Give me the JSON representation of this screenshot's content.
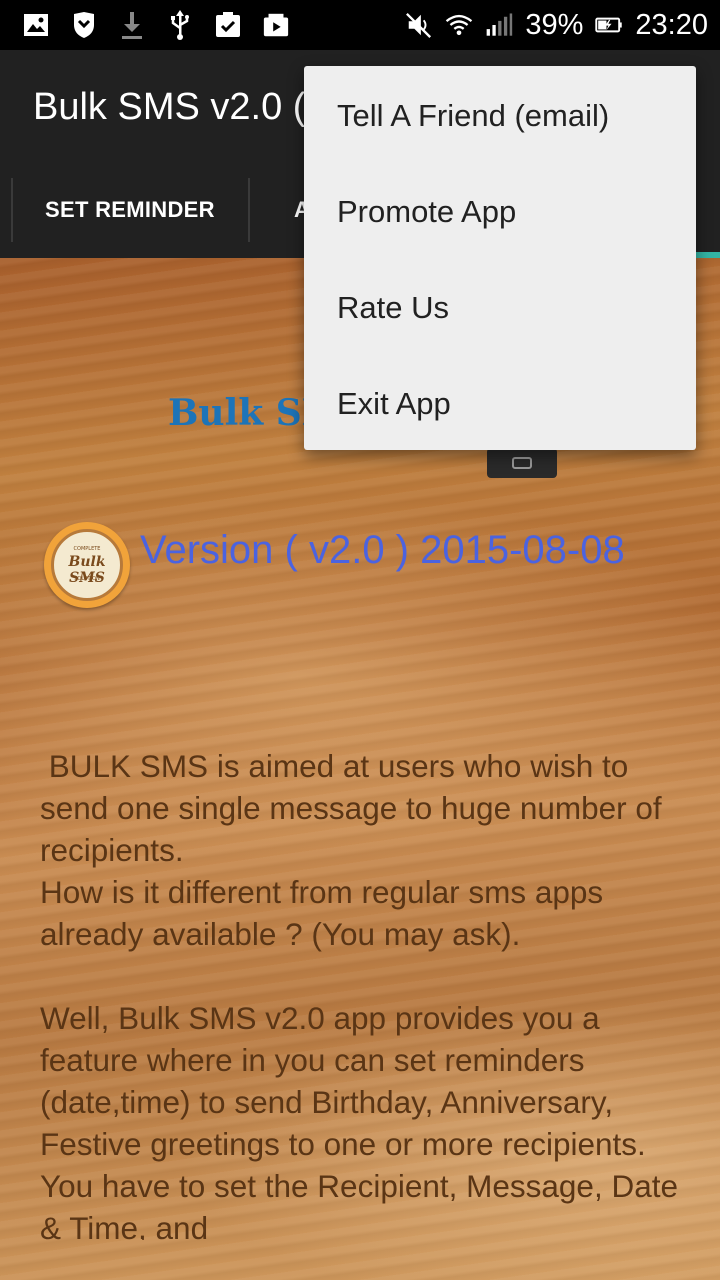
{
  "status_bar": {
    "battery": "39%",
    "time": "23:20",
    "left_icons": [
      "image-icon",
      "shield-icon",
      "download-icon",
      "usb-icon",
      "clipboard-check-icon",
      "video-icon"
    ],
    "right_icons": [
      "mute-icon",
      "wifi-icon",
      "signal-icon",
      "battery-charging-icon"
    ]
  },
  "app_bar": {
    "title": "Bulk SMS v2.0 ("
  },
  "tabs": [
    {
      "label": "SET REMINDER"
    },
    {
      "label": "A"
    }
  ],
  "content": {
    "logo_text": "Bulk SMS",
    "badge_text": "Bulk SMS",
    "badge_sub_top": "COMPLETE",
    "badge_sub_bottom": "SOLUTION",
    "version": "Version ( v2.0 ) 2015-08-08",
    "description": " BULK SMS is aimed at users who wish to send one single message to huge number of recipients.\nHow is it different from regular sms apps already available ? (You may ask).\n\nWell, Bulk SMS v2.0 app provides you a feature where in you can set reminders (date,time) to send Birthday, Anniversary, Festive greetings to one or more recipients. You have to set the Recipient, Message, Date & Time, and"
  },
  "menu": {
    "items": [
      {
        "label": "Tell A Friend (email)"
      },
      {
        "label": "Promote App"
      },
      {
        "label": "Rate Us"
      },
      {
        "label": "Exit App"
      }
    ]
  },
  "colors": {
    "app_bar": "#212121",
    "menu_bg": "#eeeeee",
    "version_text": "#4b63e0",
    "logo_text": "#1d74b8",
    "tab_indicator": "#33b5a5"
  }
}
